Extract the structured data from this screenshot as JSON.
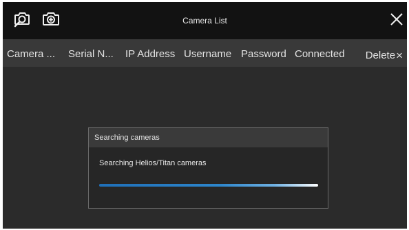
{
  "window": {
    "title": "Camera List",
    "toolbar": {
      "icons": [
        "search-camera-icon",
        "add-camera-icon"
      ],
      "close_icon": "close-icon"
    }
  },
  "table": {
    "columns": [
      "Camera ...",
      "Serial N...",
      "IP Address",
      "Username",
      "Password",
      "Connected",
      "Delete"
    ],
    "delete_icon": "×",
    "rows": []
  },
  "dialog": {
    "title": "Searching cameras",
    "message": "Searching Helios/Titan cameras",
    "progress": 1.0
  },
  "colors": {
    "titlebar_bg": "#121212",
    "header_bg": "#393939",
    "content_bg": "#2b2b2b",
    "progress_accent": "#1f6fb8"
  }
}
